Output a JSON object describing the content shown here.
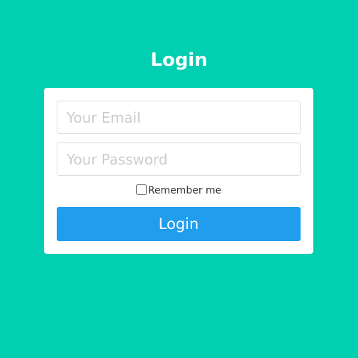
{
  "title": "Login",
  "form": {
    "email_placeholder": "Your Email",
    "email_value": "",
    "password_placeholder": "Your Password",
    "password_value": "",
    "remember_label": "Remember me",
    "remember_checked": false,
    "submit_label": "Login"
  },
  "colors": {
    "background": "#00cfb1",
    "button": "#209ded"
  }
}
